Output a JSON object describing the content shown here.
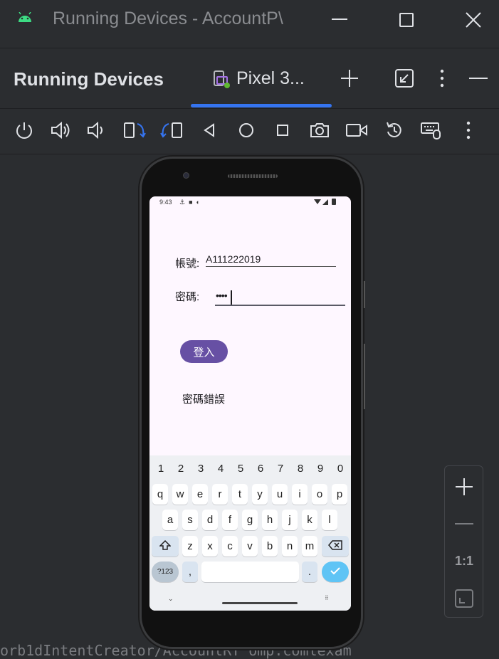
{
  "window": {
    "title": "Running Devices - AccountP\\",
    "minimize_icon": "minimize-icon",
    "maximize_icon": "maximize-icon",
    "close_icon": "close-icon"
  },
  "tool_window": {
    "title": "Running Devices",
    "tab_label": "Pixel 3...",
    "accent": "#3574f0"
  },
  "toolbar": {
    "buttons": [
      "power-icon",
      "volume-up-icon",
      "volume-down-icon",
      "rotate-left-icon",
      "rotate-right-icon",
      "back-icon",
      "home-icon",
      "overview-icon",
      "screenshot-icon",
      "screen-record-icon",
      "reset-icon",
      "keyboard-mouse-icon",
      "more-icon"
    ]
  },
  "device": {
    "status": {
      "time": "9:43"
    },
    "form": {
      "account_label": "帳號:",
      "account_value": "A111222019",
      "password_label": "密碼:",
      "password_value": "••••"
    },
    "login_button": "登入",
    "message": "密碼錯誤",
    "keyboard": {
      "numbers": [
        "1",
        "2",
        "3",
        "4",
        "5",
        "6",
        "7",
        "8",
        "9",
        "0"
      ],
      "row1": [
        "q",
        "w",
        "e",
        "r",
        "t",
        "y",
        "u",
        "i",
        "o",
        "p"
      ],
      "row2": [
        "a",
        "s",
        "d",
        "f",
        "g",
        "h",
        "j",
        "k",
        "l"
      ],
      "row3": [
        "z",
        "x",
        "c",
        "v",
        "b",
        "n",
        "m"
      ],
      "symbols_key": "?123",
      "comma_key": ",",
      "period_key": "."
    }
  },
  "zoom": {
    "ratio_label": "1:1"
  },
  "log_text": "orb1dIntentCreator/AccountRY omp.comlexam"
}
